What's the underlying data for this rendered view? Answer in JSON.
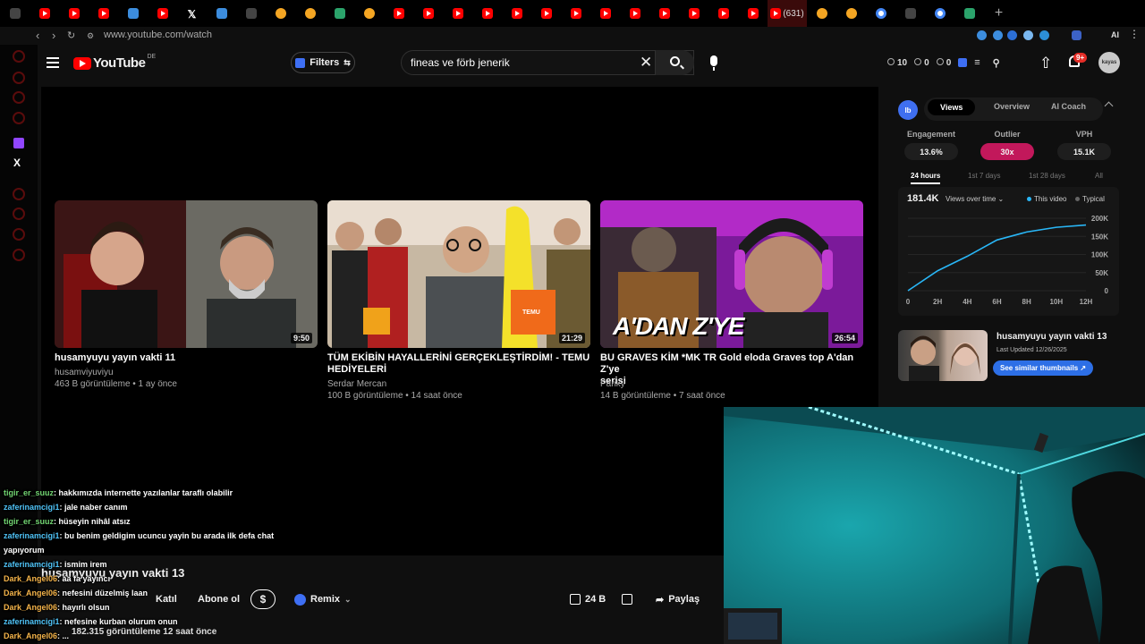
{
  "browser": {
    "url": "www.youtube.com/watch",
    "active_tab_label": "(631)",
    "tabs": [
      "yt",
      "yt",
      "yt",
      "blue",
      "yt",
      "x",
      "blue",
      "dark",
      "orange",
      "orange",
      "green",
      "orange",
      "yt",
      "yt",
      "yt",
      "yt",
      "yt",
      "yt",
      "yt",
      "yt",
      "yt",
      "yt",
      "yt",
      "yt",
      "yt",
      "active",
      "orange",
      "orange",
      "goog",
      "dark",
      "goog",
      "green"
    ]
  },
  "header": {
    "logo_text": "YouTube",
    "logo_country": "DE",
    "filters_label": "Filters",
    "search_value": "fineas ve förb jenerik",
    "counter_a": "10",
    "counter_b": "0",
    "counter_c": "0",
    "notifications_badge": "9+",
    "avatar_text": "kayas"
  },
  "videos": [
    {
      "title": "husamyuyu yayın vakti 11",
      "title2": "",
      "channel": "husamviyuviyu",
      "meta": "463 B görüntüleme • 1 ay önce",
      "duration": "9:50"
    },
    {
      "title": "TÜM EKİBİN HAYALLERİNİ GERÇEKLEŞTİRDİM! - TEMU",
      "title2": "HEDİYELERİ",
      "channel": "Serdar Mercan",
      "meta": "100 B görüntüleme • 14 saat önce",
      "duration": "21:29"
    },
    {
      "title": "BU GRAVES KİM *MK TR Gold eloda Graves top A'dan Z'ye",
      "title2": "serisi",
      "channel": "Panky",
      "meta": "14 B görüntüleme • 7 saat önce",
      "duration": "26:54"
    }
  ],
  "thumb3_overlay": "A'DAN Z'YE",
  "thumb2_badge": "TEMU",
  "panel": {
    "logo": "Ib",
    "tabs": [
      "Views",
      "Overview",
      "AI Coach"
    ],
    "metrics": [
      {
        "label": "Engagement",
        "value": "13.6%"
      },
      {
        "label": "Outlier",
        "value": "30x"
      },
      {
        "label": "VPH",
        "value": "15.1K"
      }
    ],
    "ranges": [
      "24 hours",
      "1st 7 days",
      "1st 28 days",
      "All"
    ],
    "total": "181.4K",
    "mode": "Views over time",
    "legend_this": "This video",
    "legend_typical": "Typical",
    "similar_title": "husamyuyu yayın vakti 13",
    "similar_updated": "Last Updated 12/26/2025",
    "similar_button": "See similar thumbnails ↗"
  },
  "chart_data": {
    "type": "line",
    "x": [
      "0",
      "2H",
      "4H",
      "6H",
      "8H",
      "10H",
      "12H"
    ],
    "y_ticks": [
      "0",
      "50K",
      "100K",
      "150K",
      "200K"
    ],
    "ylim": [
      0,
      200000
    ],
    "series": [
      {
        "name": "This video",
        "values": [
          0,
          55000,
          95000,
          140000,
          162000,
          175000,
          181400
        ]
      }
    ]
  },
  "bottom": {
    "title": "husamyuyu yayın vakti 13",
    "join": "Katıl",
    "subscribe": "Abone ol",
    "dollar": "$",
    "remix": "Remix",
    "likes": "24 B",
    "share": "Paylaş",
    "views_line": "182.315 görüntüleme  12 saat önce"
  },
  "chat": [
    {
      "user": "tigir_er_suuz",
      "text": ": hakkımızda internette yazılanlar taraflı olabilir",
      "color": "green"
    },
    {
      "user": "zaferinamcigi1",
      "text": ": jale naber canım",
      "color": "blue"
    },
    {
      "user": "tigir_er_suuz",
      "text": ": hüseyin nihâl atsız",
      "color": "green"
    },
    {
      "user": "zaferinamcigi1",
      "text": ": bu benim geldigim ucuncu yayin bu arada ilk defa chat",
      "color": "blue"
    },
    {
      "user": "",
      "text": "yapıyorum",
      "color": "blue"
    },
    {
      "user": "zaferinamcigi1",
      "text": ": ismim irem",
      "color": "blue"
    },
    {
      "user": "Dark_Angel06",
      "text": ": aa fa yayıncı",
      "color": "gold"
    },
    {
      "user": "Dark_Angel06",
      "text": ": nefesini düzelmiş laan",
      "color": "gold"
    },
    {
      "user": "Dark_Angel06",
      "text": ": hayırlı olsun",
      "color": "gold"
    },
    {
      "user": "zaferinamcigi1",
      "text": ": nefesine kurban olurum onun",
      "color": "blue"
    },
    {
      "user": "Dark_Angel06",
      "text": ": ...",
      "color": "gold"
    }
  ]
}
